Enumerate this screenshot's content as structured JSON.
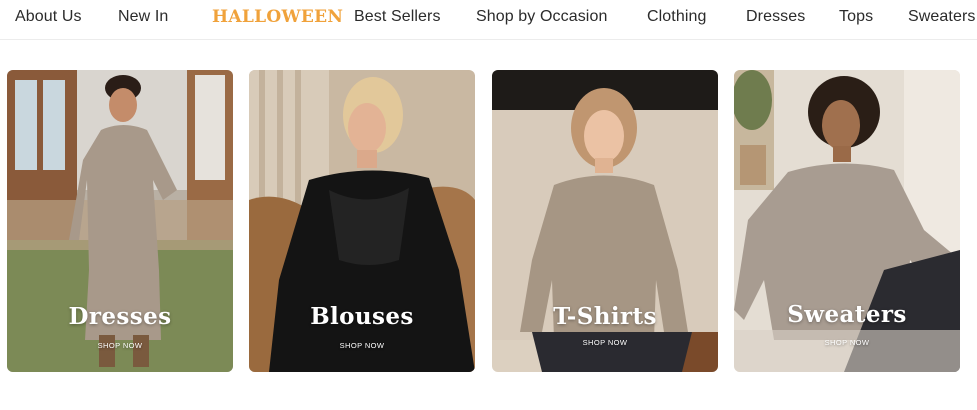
{
  "nav": {
    "items": [
      {
        "label": "About Us"
      },
      {
        "label": "New In"
      },
      {
        "label": "HALLOWEEN"
      },
      {
        "label": "Best Sellers"
      },
      {
        "label": "Shop by Occasion"
      },
      {
        "label": "Clothing"
      },
      {
        "label": "Dresses"
      },
      {
        "label": "Tops"
      },
      {
        "label": "Sweaters"
      }
    ],
    "halloween_color": "#f0a23b"
  },
  "categories": [
    {
      "title": "Dresses",
      "cta": "SHOP NOW"
    },
    {
      "title": "Blouses",
      "cta": "SHOP NOW"
    },
    {
      "title": "T-Shirts",
      "cta": "SHOP NOW"
    },
    {
      "title": "Sweaters",
      "cta": "SHOP NOW"
    }
  ]
}
